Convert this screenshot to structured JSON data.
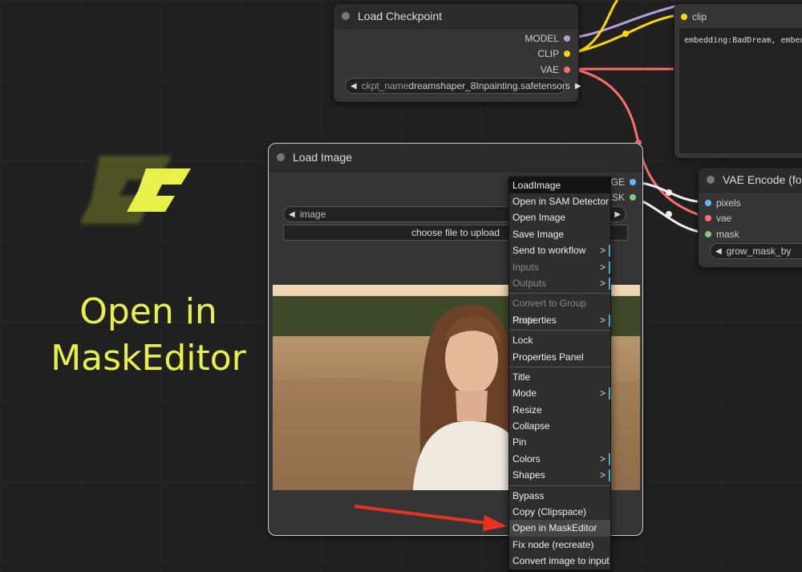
{
  "promo": {
    "line1": "Open in",
    "line2": "MaskEditor"
  },
  "load_checkpoint": {
    "title": "Load Checkpoint",
    "outputs": [
      "MODEL",
      "CLIP",
      "VAE"
    ],
    "widget_label": "ckpt_name",
    "widget_value": "dreamshaper_8Inpainting.safetensors"
  },
  "text_node": {
    "input": "clip",
    "text": "embedding:BadDream, embedd"
  },
  "vae_encode": {
    "title": "VAE Encode (for",
    "inputs": [
      "pixels",
      "vae",
      "mask"
    ],
    "widget_value": "grow_mask_by"
  },
  "load_image": {
    "title": "Load Image",
    "outputs": [
      "IMAGE",
      "MASK"
    ],
    "widget_label": "image",
    "upload_label": "choose file to upload"
  },
  "context_menu": {
    "title": "LoadImage",
    "items": [
      {
        "label": "Open in SAM Detector"
      },
      {
        "label": "Open Image"
      },
      {
        "label": "Save Image"
      },
      {
        "label": "Send to workflow",
        "sub": true
      },
      {
        "label": "Inputs",
        "sub": true,
        "disabled": true
      },
      {
        "label": "Outputs",
        "sub": true,
        "disabled": true
      },
      {
        "sep": true
      },
      {
        "label": "Convert to Group Node",
        "disabled": true
      },
      {
        "label": "Properties",
        "sub": true
      },
      {
        "sep": true
      },
      {
        "label": "Lock"
      },
      {
        "label": "Properties Panel"
      },
      {
        "sep": true
      },
      {
        "label": "Title"
      },
      {
        "label": "Mode",
        "sub": true
      },
      {
        "label": "Resize"
      },
      {
        "label": "Collapse"
      },
      {
        "label": "Pin"
      },
      {
        "label": "Colors",
        "sub": true
      },
      {
        "label": "Shapes",
        "sub": true
      },
      {
        "sep": true
      },
      {
        "label": "Bypass"
      },
      {
        "label": "Copy (Clipspace)"
      },
      {
        "label": "Open in MaskEditor",
        "highlight": true
      },
      {
        "label": "Fix node (recreate)"
      },
      {
        "label": "Convert image to input"
      }
    ]
  },
  "colors": {
    "accent_yellow": "#e8f04a",
    "slot_model": "#b39ddb",
    "slot_clip": "#ffd500",
    "slot_vae": "#ff6e6e",
    "slot_image": "#64b5f6",
    "slot_mask": "#81c784",
    "arrow": "#e8321e"
  }
}
